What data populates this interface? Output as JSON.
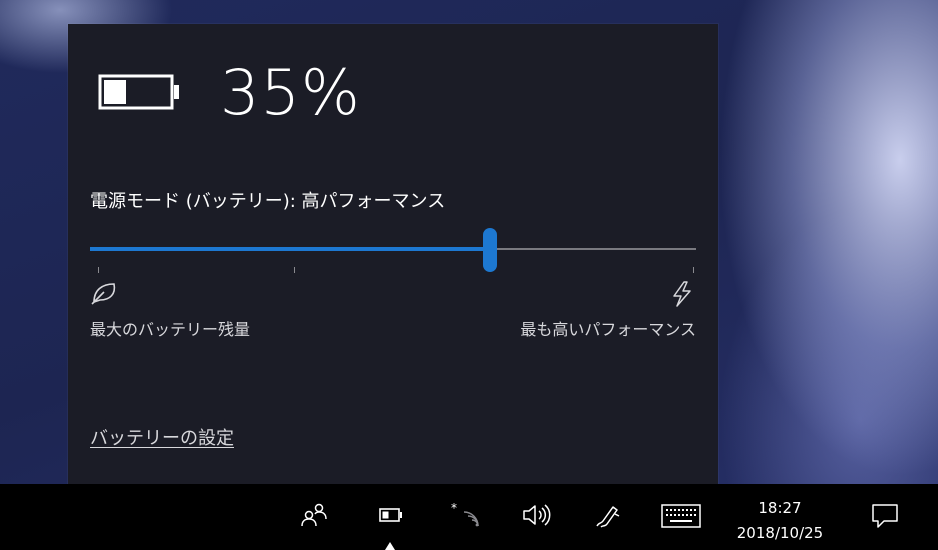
{
  "battery_flyout": {
    "percent_text": "35%",
    "battery_level": 0.35,
    "power_mode_label": "電源モード (バッテリー): 高パフォーマンス",
    "slider": {
      "level": 0.66,
      "left_label": "最大のバッテリー残量",
      "right_label": "最も高いパフォーマンス",
      "left_icon": "leaf-icon",
      "right_icon": "lightning-bolt-icon"
    },
    "settings_link": "バッテリーの設定"
  },
  "taskbar": {
    "icons": [
      "people-icon",
      "battery-icon",
      "wifi-airplane-icon",
      "volume-icon",
      "pen-workspace-icon",
      "touch-keyboard-icon",
      "action-center-icon"
    ],
    "clock": {
      "time": "18:27",
      "date": "2018/10/25"
    }
  },
  "colors": {
    "accent": "#1d78d1",
    "flyout_background": "#1b1c26",
    "taskbar_background": "#000000"
  }
}
